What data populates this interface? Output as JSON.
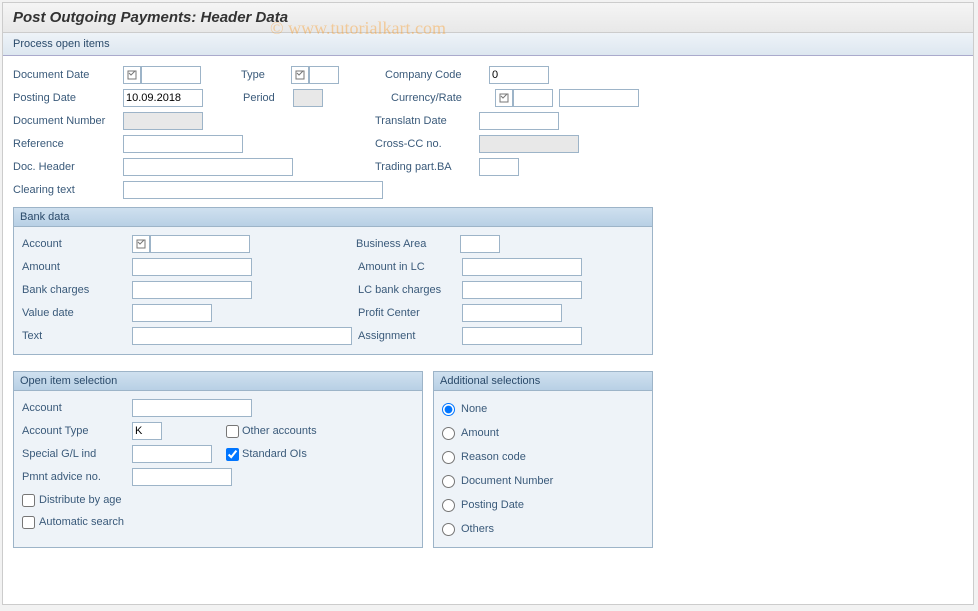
{
  "title": "Post Outgoing Payments: Header Data",
  "toolbar": {
    "process": "Process open items"
  },
  "watermark": "© www.tutorialkart.com",
  "header": {
    "document_date": {
      "label": "Document Date",
      "value": ""
    },
    "type": {
      "label": "Type",
      "value": ""
    },
    "company_code": {
      "label": "Company Code",
      "value": "0"
    },
    "posting_date": {
      "label": "Posting Date",
      "value": "10.09.2018"
    },
    "period": {
      "label": "Period",
      "value": ""
    },
    "currency_rate": {
      "label": "Currency/Rate",
      "value": "",
      "rate_value": ""
    },
    "document_number": {
      "label": "Document Number",
      "value": ""
    },
    "translatn_date": {
      "label": "Translatn Date",
      "value": ""
    },
    "reference": {
      "label": "Reference",
      "value": ""
    },
    "cross_cc": {
      "label": "Cross-CC no.",
      "value": ""
    },
    "doc_header": {
      "label": "Doc. Header",
      "value": ""
    },
    "trading_part_ba": {
      "label": "Trading part.BA",
      "value": ""
    },
    "clearing_text": {
      "label": "Clearing text",
      "value": ""
    }
  },
  "bank": {
    "title": "Bank data",
    "account": {
      "label": "Account",
      "value": ""
    },
    "business_area": {
      "label": "Business Area",
      "value": ""
    },
    "amount": {
      "label": "Amount",
      "value": ""
    },
    "amount_lc": {
      "label": "Amount in LC",
      "value": ""
    },
    "bank_charges": {
      "label": "Bank charges",
      "value": ""
    },
    "lc_bank_charges": {
      "label": "LC bank charges",
      "value": ""
    },
    "value_date": {
      "label": "Value date",
      "value": ""
    },
    "profit_center": {
      "label": "Profit Center",
      "value": ""
    },
    "text": {
      "label": "Text",
      "value": ""
    },
    "assignment": {
      "label": "Assignment",
      "value": ""
    }
  },
  "open_item": {
    "title": "Open item selection",
    "account": {
      "label": "Account",
      "value": ""
    },
    "account_type": {
      "label": "Account Type",
      "value": "K"
    },
    "other_accounts": {
      "label": "Other accounts",
      "checked": false
    },
    "special_gl": {
      "label": "Special G/L ind",
      "value": ""
    },
    "standard_ois": {
      "label": "Standard OIs",
      "checked": true
    },
    "pmnt_advice": {
      "label": "Pmnt advice no.",
      "value": ""
    },
    "distribute": {
      "label": "Distribute by age",
      "checked": false
    },
    "auto_search": {
      "label": "Automatic search",
      "checked": false
    }
  },
  "additional": {
    "title": "Additional selections",
    "options": [
      "None",
      "Amount",
      "Reason code",
      "Document Number",
      "Posting Date",
      "Others"
    ],
    "selected": "None"
  }
}
